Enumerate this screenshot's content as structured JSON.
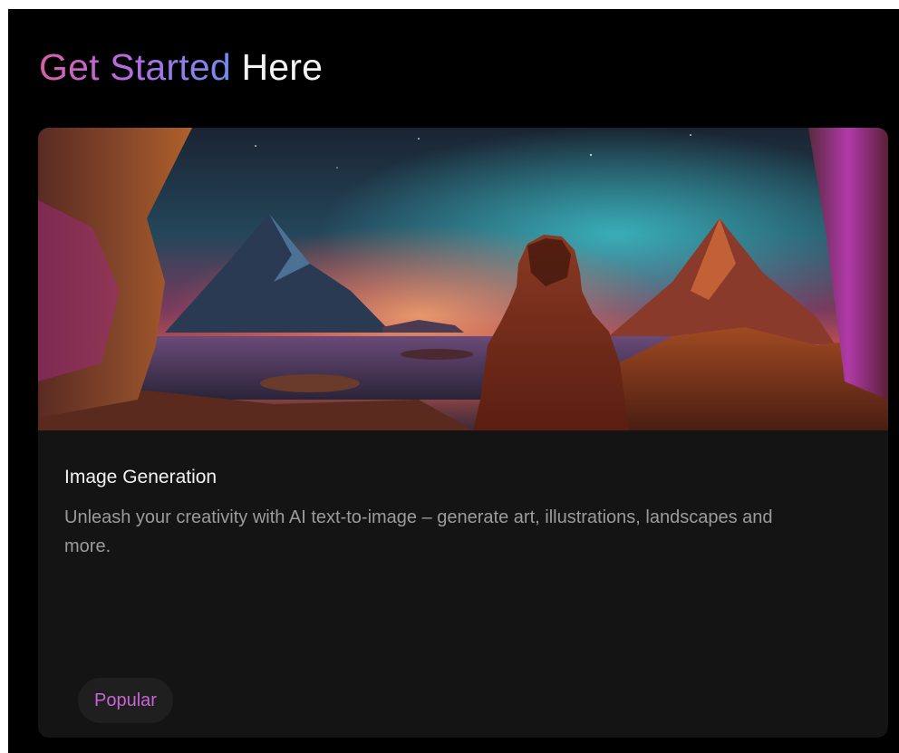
{
  "section": {
    "heading_accent": "Get Started",
    "heading_rest": "Here"
  },
  "card": {
    "image_icon": "hooded-figure-mountain-landscape-image",
    "title": "Image Generation",
    "description": "Unleash your creativity with AI text-to-image – generate art, illustrations, landscapes and more.",
    "badge": "Popular"
  },
  "colors": {
    "background": "#000000",
    "card": "#141414",
    "badge_text": "#c665d6",
    "gradient_start": "#d65fa8",
    "gradient_end": "#6f8dec"
  }
}
